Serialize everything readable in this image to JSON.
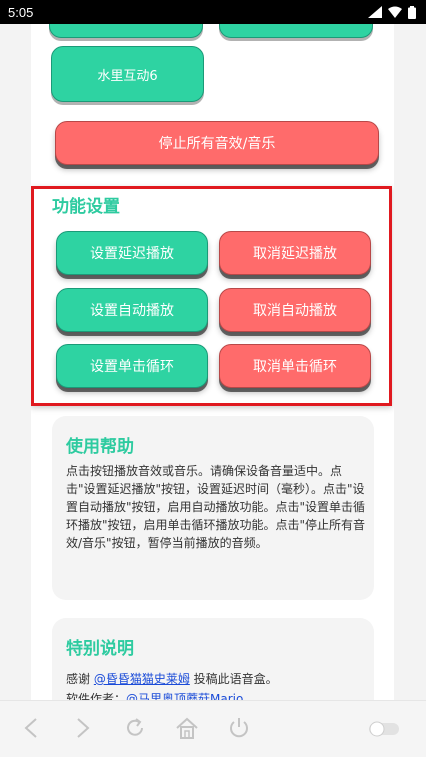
{
  "status_bar": {
    "time": "5:05"
  },
  "buttons_top": {
    "water6": "水里互动6"
  },
  "stop_all": "停止所有音效/音乐",
  "function_settings": {
    "title": "功能设置",
    "set_delay": "设置延迟播放",
    "cancel_delay": "取消延迟播放",
    "set_auto": "设置自动播放",
    "cancel_auto": "取消自动播放",
    "set_loop": "设置单击循环",
    "cancel_loop": "取消单击循环"
  },
  "help": {
    "title": "使用帮助",
    "text": "点击按钮播放音效或音乐。请确保设备音量适中。点击\"设置延迟播放\"按钮，设置延迟时间（毫秒）。点击\"设置自动播放\"按钮，启用自动播放功能。点击\"设置单击循环播放\"按钮，启用单击循环播放功能。点击\"停止所有音效/音乐\"按钮，暂停当前播放的音频。"
  },
  "special": {
    "title": "特别说明",
    "thanks_prefix": "感谢 ",
    "thanks_link": "@昏昏猫猫史莱姆",
    "thanks_suffix": " 投稿此语音盒。",
    "author_prefix": "软件作者：",
    "author_link": "@马里奥顶蘑菇Mario"
  },
  "colors": {
    "green": "#2ed3a2",
    "red": "#ff6b6b",
    "title_green": "#2ecba0",
    "highlight_border": "#e0191f"
  }
}
